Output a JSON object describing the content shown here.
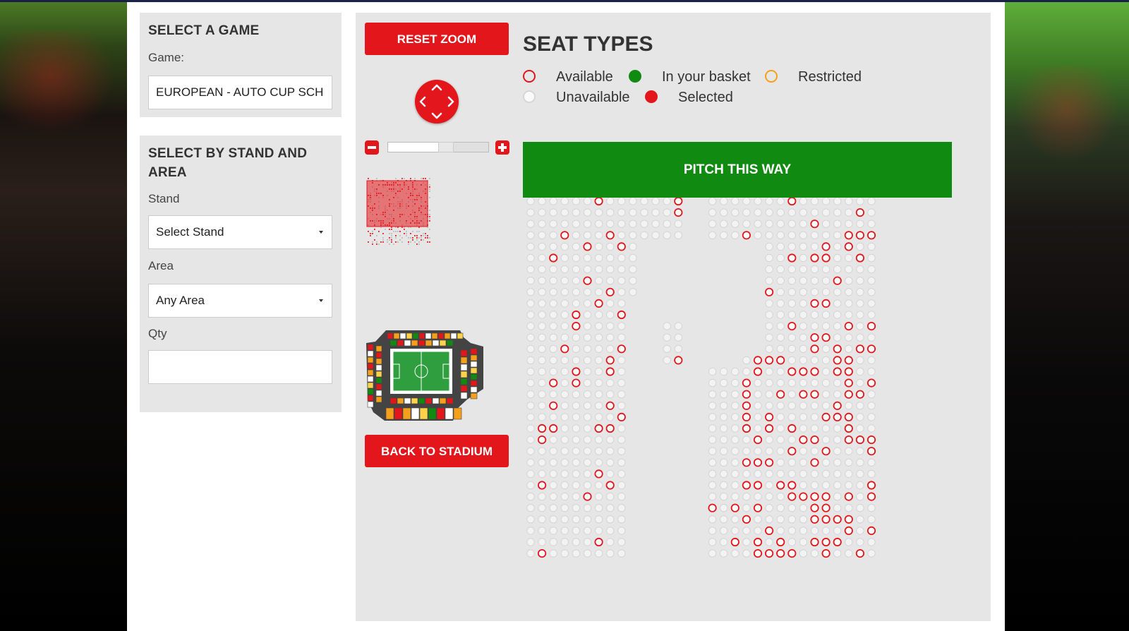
{
  "colors": {
    "accent": "#e3161b",
    "pitch": "#118a12",
    "panel": "#e6e6e6",
    "basket": "#118a12",
    "restricted": "#f5a01a",
    "unavailable": "#cfcfcf"
  },
  "game_panel": {
    "title": "SELECT A GAME",
    "label": "Game:",
    "value": "EUROPEAN - AUTO CUP SCH"
  },
  "stand_panel": {
    "title": "SELECT BY STAND AND AREA",
    "stand_label": "Stand",
    "stand_value": "Select Stand",
    "area_label": "Area",
    "area_value": "Any Area",
    "qty_label": "Qty",
    "qty_value": ""
  },
  "map": {
    "reset_label": "RESET ZOOM",
    "back_label": "BACK TO STADIUM",
    "pad_icon": "arrows-pan-icon",
    "zoom_out_icon": "minus-icon",
    "zoom_in_icon": "plus-icon",
    "zoom_level": 0.58,
    "seat_types_title": "SEAT TYPES",
    "legend": [
      {
        "key": "available",
        "label": "Available"
      },
      {
        "key": "basket",
        "label": "In your basket"
      },
      {
        "key": "restricted",
        "label": "Restricted"
      },
      {
        "key": "unavailable",
        "label": "Unavailable"
      },
      {
        "key": "selected",
        "label": "Selected"
      }
    ],
    "pitch_label": "PITCH THIS WAY",
    "minimap_icon": "section-minimap",
    "stadium_icon": "stadium-overview-icon"
  }
}
